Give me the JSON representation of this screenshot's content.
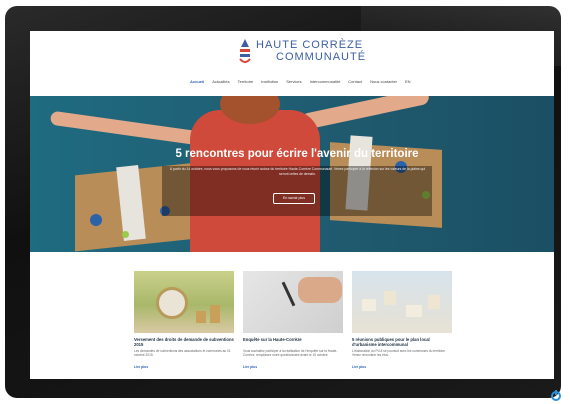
{
  "site": {
    "logo_line1": "HAUTE CORRÈZE",
    "logo_line2": "COMMUNAUTÉ"
  },
  "nav": {
    "items": [
      "Accueil",
      "Actualités",
      "Territoire",
      "Institution",
      "Services",
      "Intercommunalité",
      "Contact",
      "Nous contacter",
      "EN"
    ],
    "active_index": 0
  },
  "hero": {
    "title": "5 rencontres pour écrire l'avenir du territoire",
    "subtitle": "À partir du 14 octobre, nous vous proposons de vous réunir autour du territoire Haute-Corrèze Communauté. Venez participer à la réflexion sur les valeurs de la plaine qui seront celles de demain.",
    "button": "En savoir plus"
  },
  "cards": [
    {
      "title": "Versement des droits de demande de subventions 2015",
      "text": "Les demandes de subventions des associations et communes au 01 octobre 2015.",
      "link": "Lire plus"
    },
    {
      "title": "Enquête sur la Haute-Corrèze",
      "text": "Vous souhaitez participer à la réalisation de l'enquête sur la Haute-Corrèze, remplissez notre questionnaire avant le 15 octobre.",
      "link": "Lire plus"
    },
    {
      "title": "5 réunions publiques pour le plan local d'urbanisme intercommunal",
      "text": "L'élaboration du PLUi se poursuit avec les communes du territoire. Venez rencontrer les élus.",
      "link": "Lire plus"
    }
  ],
  "colors": {
    "brand_blue": "#3d5ea3",
    "hero_bg": "#1e5a6e",
    "link_blue": "#2d63b8",
    "power_led": "#2d8fd6"
  }
}
